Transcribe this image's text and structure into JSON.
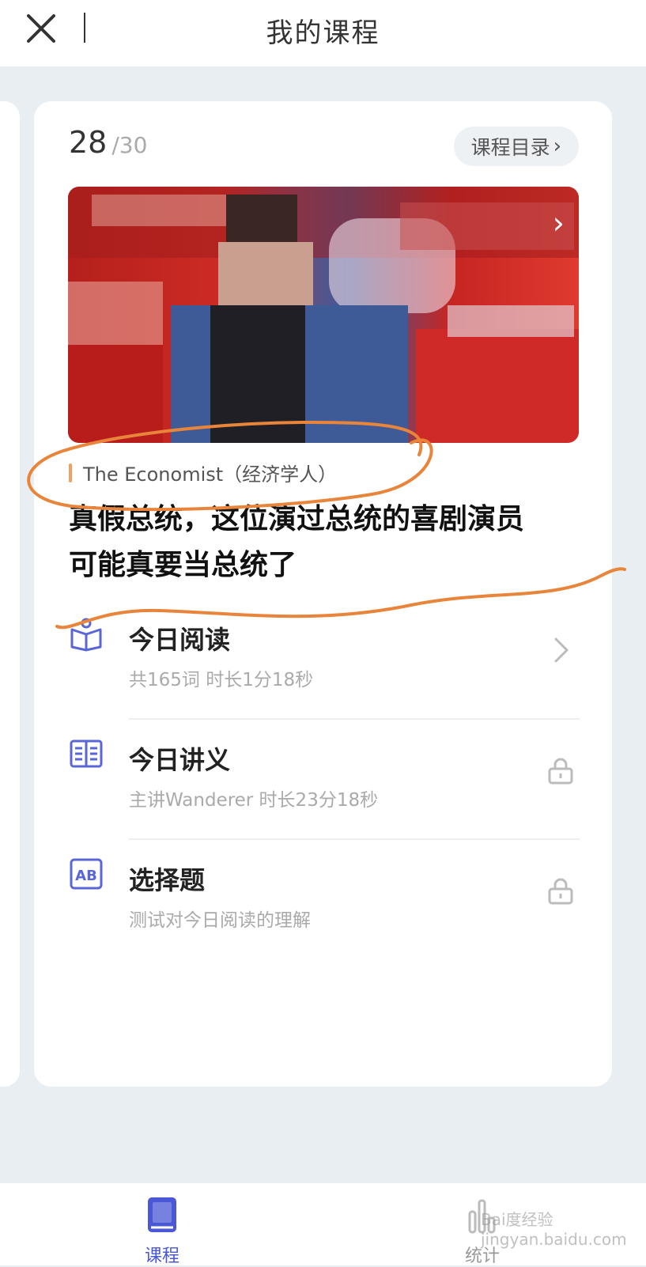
{
  "header": {
    "title": "我的课程",
    "close_icon": "close-icon"
  },
  "card": {
    "progress_current": "28",
    "progress_total": "/30",
    "catalog_label": "课程目录",
    "cover_image": "blurred-lecture-photo",
    "source": "The Economist（经济学人）",
    "headline_line1": "真假总统，这位演过总统的喜剧演员",
    "headline_line2": "可能真要当总统了"
  },
  "items": [
    {
      "title": "今日阅读",
      "subtitle": "共165词 时长1分18秒",
      "icon": "reading-icon",
      "right_icon": "chevron-right-icon"
    },
    {
      "title": "今日讲义",
      "subtitle": "主讲Wanderer 时长23分18秒",
      "icon": "handout-icon",
      "right_icon": "lock-icon"
    },
    {
      "title": "选择题",
      "subtitle": "测试对今日阅读的理解",
      "icon": "quiz-ab-icon",
      "right_icon": "lock-icon"
    }
  ],
  "tabbar": {
    "tabs": [
      {
        "label": "课程",
        "icon": "book-icon",
        "active": true
      },
      {
        "label": "统计",
        "icon": "stats-icon",
        "active": false
      }
    ],
    "watermark": "Bai度经验 jingyan.baidu.com"
  },
  "colors": {
    "accent": "#4a57d6",
    "annotation": "#e8853a",
    "background": "#e8eef1"
  }
}
